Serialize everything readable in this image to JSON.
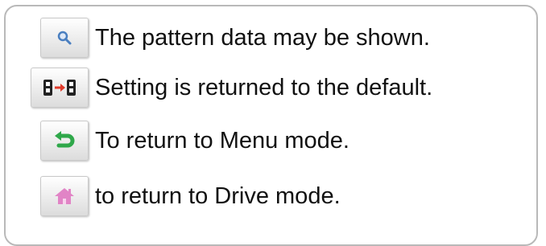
{
  "rows": [
    {
      "icon": "magnifier-icon",
      "text": "The pattern data may be shown."
    },
    {
      "icon": "reset-default-icon",
      "text": "Setting is returned to the default."
    },
    {
      "icon": "return-arrow-icon",
      "text": "To return to Menu mode."
    },
    {
      "icon": "home-icon",
      "text": "to return to Drive mode."
    }
  ],
  "colors": {
    "border": "#b9b9b9",
    "text": "#111111",
    "button_bg": "#e8e8e8",
    "magnifier": "#4a7fc0",
    "reset_icon": "#222222",
    "reset_arrow": "#e03a2a",
    "return_arrow": "#2fa84a",
    "home": "#e184c6"
  }
}
